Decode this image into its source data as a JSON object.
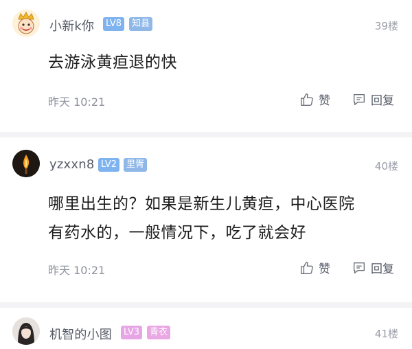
{
  "colors": {
    "lv_badge": "#7fb3f0",
    "title_badge_blue": "#8fb8e8",
    "lv3_badge": "#e6a6e6",
    "title_badge_pink": "#e9a7e3",
    "divider": "#f3f3f6"
  },
  "posts": [
    {
      "username": "小新k你",
      "level": "LV8",
      "title": "知县",
      "floor": "39楼",
      "content": [
        "去游泳黄疸退的快"
      ],
      "time": "昨天 10:21",
      "like_label": "赞",
      "reply_label": "回复",
      "avatar_icon": "cartoon-king-avatar-icon"
    },
    {
      "username": "yzxxn8",
      "level": "LV2",
      "title": "里胥",
      "floor": "40楼",
      "content": [
        "哪里出生的？如果是新生儿黄疸，中心医院",
        "有药水的，一般情况下，吃了就会好"
      ],
      "time": "昨天 10:21",
      "like_label": "赞",
      "reply_label": "回复",
      "avatar_icon": "candle-flame-avatar-icon"
    },
    {
      "username": "机智的小图",
      "level": "LV3",
      "title": "青衣",
      "floor": "41楼",
      "avatar_icon": "girl-photo-avatar-icon"
    }
  ]
}
